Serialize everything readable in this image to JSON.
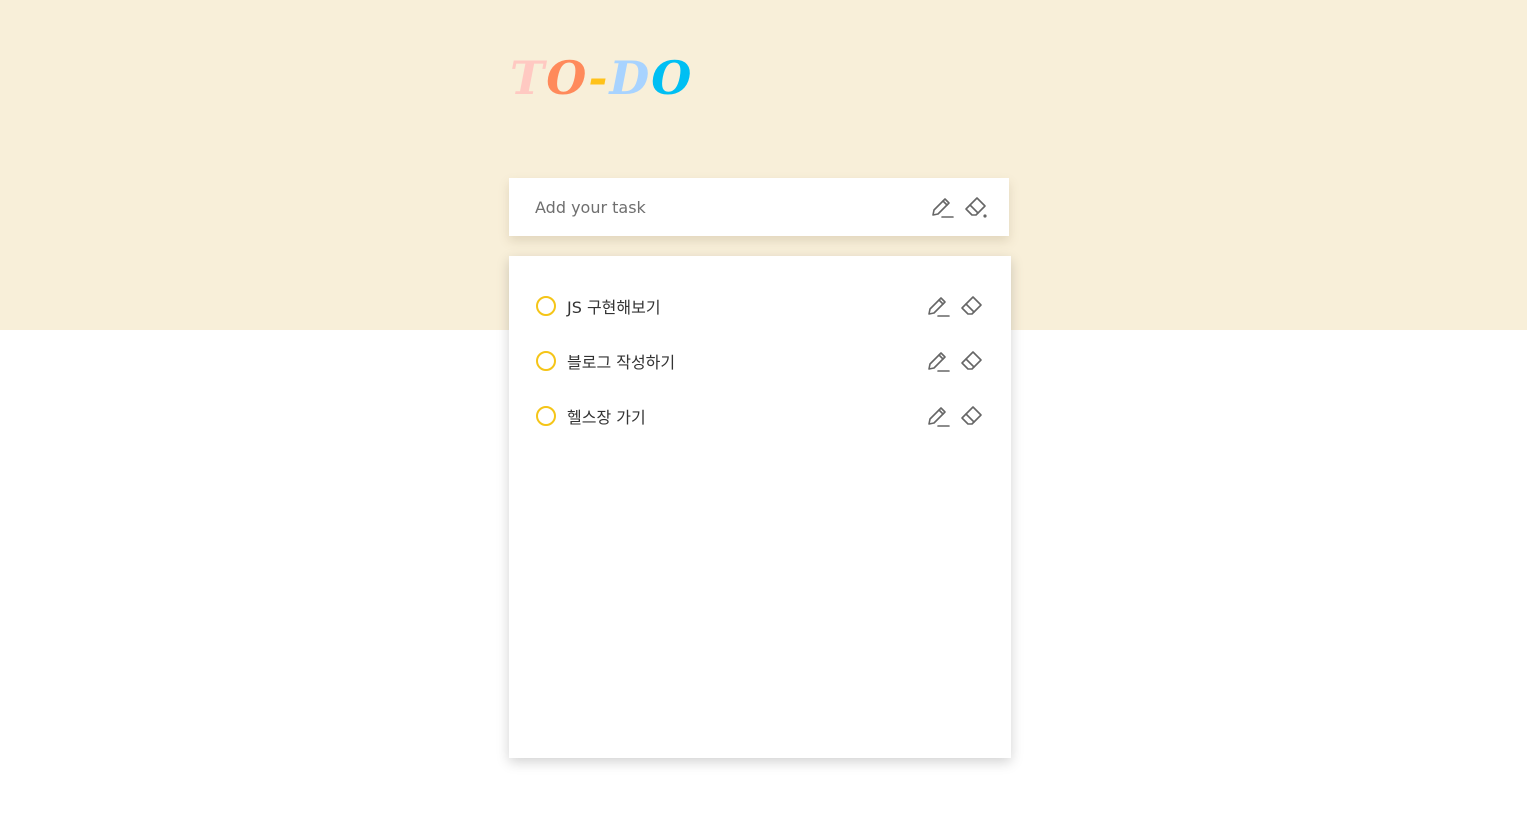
{
  "header": {
    "logo": {
      "letters": [
        {
          "char": "T",
          "color": "#ffc9c2"
        },
        {
          "char": "O",
          "color": "#ff8a5b"
        },
        {
          "char": "-",
          "color": "#ffc21a"
        },
        {
          "char": "D",
          "color": "#a8d3ff"
        },
        {
          "char": "O",
          "color": "#00bff3"
        }
      ]
    }
  },
  "input": {
    "placeholder": "Add your task",
    "value": "",
    "add_icon": "pencil-icon",
    "clear_icon": "eraser-icon"
  },
  "tasks": [
    {
      "text": "JS 구현해보기",
      "done": false
    },
    {
      "text": "블로그 작성하기",
      "done": false
    },
    {
      "text": "헬스장 가기",
      "done": false
    }
  ],
  "colors": {
    "header_bg": "#f8efd9",
    "check_circle": "#f5c518",
    "icon_stroke": "#666666"
  }
}
